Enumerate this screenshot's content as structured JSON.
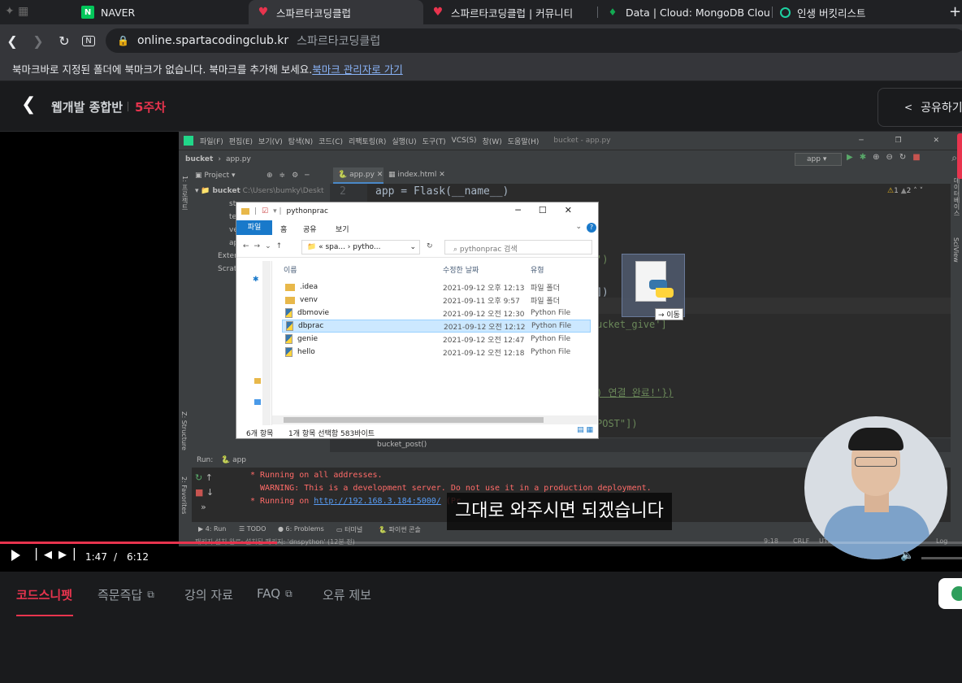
{
  "browser": {
    "tabs": [
      {
        "title": "NAVER",
        "icon": "naver-icon"
      },
      {
        "title": "스파르타코딩클럽",
        "icon": "sparta-heart-icon",
        "active": true
      },
      {
        "title": "스파르타코딩클럽 | 커뮤니티",
        "icon": "sparta-heart-icon"
      },
      {
        "title": "Data | Cloud: MongoDB Cloud",
        "icon": "mongodb-leaf-icon"
      },
      {
        "title": "인생 버킷리스트",
        "icon": "globe-icon"
      }
    ],
    "url_domain": "online.spartacodingclub.kr",
    "url_title": "스파르타코딩클럽",
    "bookmark_message": "북마크바로 지정된 폴더에 북마크가 없습니다. 북마크를 추가해 보세요.",
    "bookmark_link": "북마크 관리자로 가기"
  },
  "course": {
    "title": "웹개발 종합반",
    "week": "5주차",
    "share_label": "공유하기"
  },
  "ide": {
    "menu": [
      "파일(F)",
      "편집(E)",
      "보기(V)",
      "탐색(N)",
      "코드(C)",
      "리팩토링(R)",
      "실행(U)",
      "도구(T)",
      "VCS(S)",
      "창(W)",
      "도움말(H)"
    ],
    "window_title": "bucket - app.py",
    "breadcrumb_project": "bucket",
    "breadcrumb_file": "app.py",
    "project_label": "Project",
    "run_config": "app",
    "editor_tabs": [
      "app.py",
      "index.html"
    ],
    "project_root": "bucket",
    "project_path": "C:\\Users\\bumky\\Deskt",
    "tree_items": [
      "st",
      "te",
      "ve",
      "ap"
    ],
    "external_libs": "Extern",
    "scratches": "Scrat",
    "line_number": "2",
    "code_line": "app = Flask(__name__)",
    "code_frag_1": "')",
    "code_frag_2": "])",
    "code_frag_3": "ucket_give']",
    "code_frag_4": ") 연결 완료!'})",
    "code_frag_5": "POST\"])",
    "code_footer": "bucket_post()",
    "warnings": "1",
    "weak_warnings": "2",
    "side_left": [
      "1: 프로젝트",
      "Z: Structure",
      "2: Favorites"
    ],
    "side_right": [
      "데이터베이스",
      "SciView"
    ],
    "run_label": "Run:",
    "run_config_tab": "app",
    "console": [
      "* Running on all addresses.",
      "  WARNING: This is a development server. Do not use it in a production deployment.",
      "* Running on "
    ],
    "console_link": "http://192.168.3.184:5000/",
    "console_tail": " (Pr",
    "bottom_tabs": [
      "4: Run",
      "TODO",
      "6: Problems",
      "터미널",
      "파이썬 콘솔"
    ],
    "status_left": "패키지 설치 완료: 설치된 패키지: 'dnspython' (12분 전)",
    "status_right": [
      "9:18",
      "CRLF",
      "UTF-8",
      "bucket",
      "Log"
    ]
  },
  "explorer": {
    "title": "pythonprac",
    "ribbon_tabs": [
      "파일",
      "홈",
      "공유",
      "보기"
    ],
    "path": [
      "spa...",
      "pytho..."
    ],
    "search_placeholder": "pythonprac 검색",
    "columns": [
      "이름",
      "수정한 날짜",
      "유형"
    ],
    "files": [
      {
        "name": ".idea",
        "date": "2021-09-12 오후 12:13",
        "type": "파일 폴더",
        "kind": "folder"
      },
      {
        "name": "venv",
        "date": "2021-09-11 오후 9:57",
        "type": "파일 폴더",
        "kind": "folder"
      },
      {
        "name": "dbmovie",
        "date": "2021-09-12 오전 12:30",
        "type": "Python File",
        "kind": "py"
      },
      {
        "name": "dbprac",
        "date": "2021-09-12 오전 12:12",
        "type": "Python File",
        "kind": "py",
        "selected": true
      },
      {
        "name": "genie",
        "date": "2021-09-12 오전 12:47",
        "type": "Python File",
        "kind": "py"
      },
      {
        "name": "hello",
        "date": "2021-09-12 오전 12:18",
        "type": "Python File",
        "kind": "py"
      }
    ],
    "status_count": "6개 항목",
    "status_selection": "1개 항목 선택함 583바이트"
  },
  "drag": {
    "label": "→ 이동"
  },
  "subtitle": "그대로 와주시면 되겠습니다",
  "player": {
    "current_time": "1:47",
    "separator": "/",
    "duration": "6:12",
    "progress": 0.2876
  },
  "lower_tabs": [
    {
      "label": "코드스니펫",
      "active": true
    },
    {
      "label": "즉문즉답",
      "external": true
    },
    {
      "label": "강의 자료"
    },
    {
      "label": "FAQ",
      "external": true
    },
    {
      "label": "오류 제보"
    }
  ],
  "colors": {
    "accent_red": "#e8344e",
    "console_red": "#ff6b68",
    "link_blue": "#589df6",
    "selection_blue": "#cce8ff"
  }
}
